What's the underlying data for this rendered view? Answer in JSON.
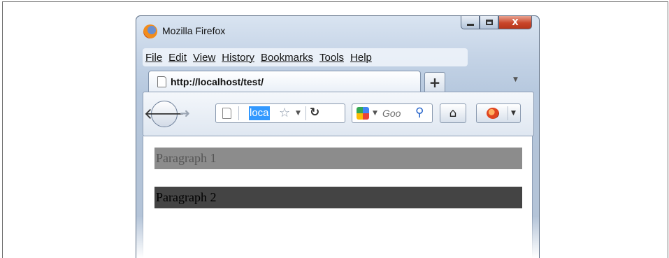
{
  "window": {
    "title": "Mozilla Firefox",
    "caption_close": "X"
  },
  "menubar": {
    "items": [
      "File",
      "Edit",
      "View",
      "History",
      "Bookmarks",
      "Tools",
      "Help"
    ]
  },
  "tabs": [
    {
      "label": "http://localhost/test/"
    }
  ],
  "new_tab_label": "+",
  "navbar": {
    "url_text": "loca",
    "search_placeholder": "Goo"
  },
  "content": {
    "paragraphs": [
      {
        "text": "Paragraph 1",
        "background": "#8c8c8c",
        "color": "#555555"
      },
      {
        "text": "Paragraph 2",
        "background": "#444444",
        "color": "#000000"
      }
    ]
  },
  "icons": {
    "firefox": "firefox-logo-icon",
    "back": "back-arrow-icon",
    "forward": "forward-arrow-icon",
    "page": "document-icon",
    "bookmark": "star-icon",
    "reload": "reload-icon",
    "search_engine": "google-icon",
    "search": "magnifier-icon",
    "home": "home-icon",
    "addon": "ladybug-icon"
  }
}
